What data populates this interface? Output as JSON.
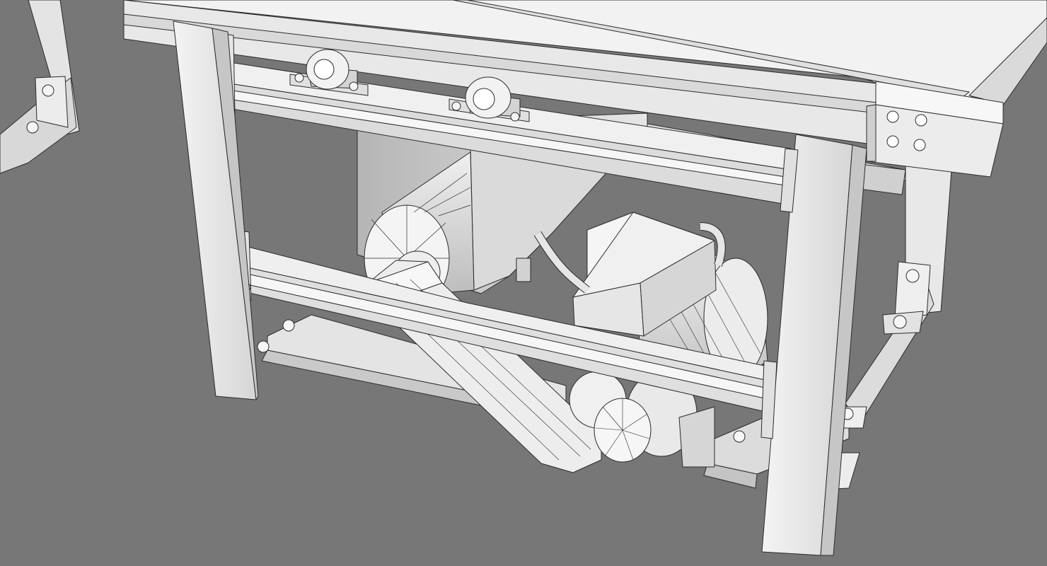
{
  "scene": {
    "subject": "table-saw-wireframe-render",
    "colors": {
      "background": "#777777",
      "surface_light": "#f2f2f2",
      "surface_mid": "#dcdcdc",
      "surface_shadow": "#bdbdbd",
      "wire": "#2b2b2b"
    }
  }
}
